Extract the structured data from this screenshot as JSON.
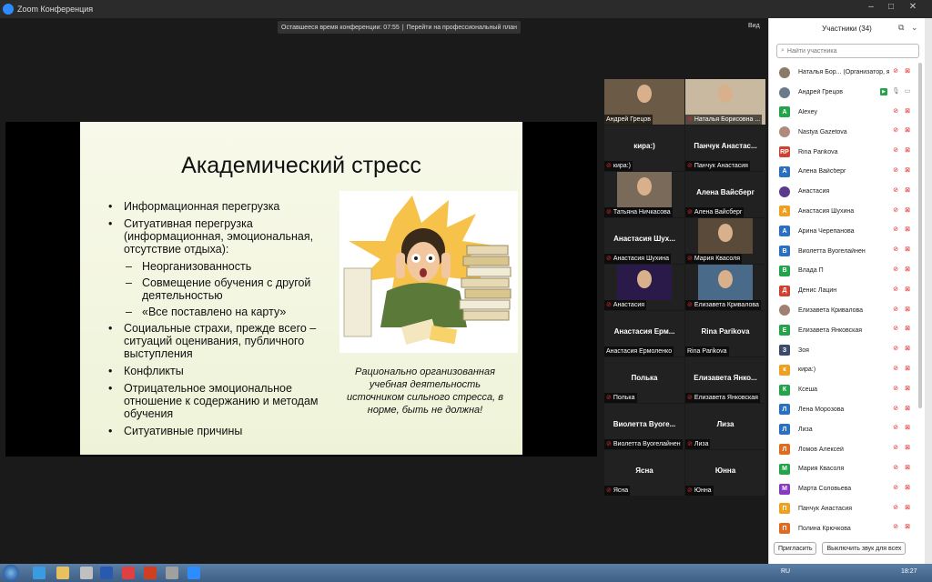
{
  "window": {
    "title": "Zoom Конференция",
    "view_label": "Вид"
  },
  "banner": {
    "time_text": "Оставшееся время конференции: 07:55",
    "upgrade_text": "Перейти на профессиональный план"
  },
  "slide": {
    "title": "Академический стресс",
    "bullets": [
      {
        "text": "Информационная перегрузка",
        "level": 1
      },
      {
        "text": "Ситуативная перегрузка (информационная, эмоциональная, отсутствие отдыха):",
        "level": 1
      },
      {
        "text": "Неорганизованность",
        "level": 2
      },
      {
        "text": "Совмещение обучения с другой деятельностью",
        "level": 2
      },
      {
        "text": "«Все поставлено на карту»",
        "level": 2
      },
      {
        "text": "Социальные страхи, прежде всего – ситуаций оценивания, публичного выступления",
        "level": 1
      },
      {
        "text": "Конфликты",
        "level": 1
      },
      {
        "text": "Отрицательное эмоциональное отношение к содержанию и методам обучения",
        "level": 1
      },
      {
        "text": "Ситуативные причины",
        "level": 1
      }
    ],
    "note": "Рационально организованная учебная деятельность источником сильного стресса, в норме, быть не должна!"
  },
  "gallery": [
    {
      "label": "Андрей Грецов",
      "big": "",
      "video": true,
      "muted": false,
      "active": true
    },
    {
      "label": "Наталья Борисовна ...",
      "big": "",
      "video": true,
      "muted": true,
      "active": false
    },
    {
      "label": "кира:)",
      "big": "кира:)",
      "video": false,
      "muted": true,
      "active": false
    },
    {
      "label": "Панчук Анастасия",
      "big": "Панчук Анастас...",
      "video": false,
      "muted": true,
      "active": false
    },
    {
      "label": "Татьяна Ничкасова",
      "big": "",
      "video": true,
      "muted": true,
      "active": false
    },
    {
      "label": "Алена Вайсберг",
      "big": "Алена Вайсберг",
      "video": false,
      "muted": true,
      "active": false
    },
    {
      "label": "Анастасия Шухина",
      "big": "Анастасия Шух...",
      "video": false,
      "muted": true,
      "active": false
    },
    {
      "label": "Мария Квасоля",
      "big": "",
      "video": true,
      "muted": true,
      "active": false
    },
    {
      "label": "Анастасия",
      "big": "",
      "video": true,
      "muted": true,
      "active": false
    },
    {
      "label": "Елизавета Кривалова",
      "big": "",
      "video": true,
      "muted": true,
      "active": false
    },
    {
      "label": "Анастасия Ермоленко",
      "big": "Анастасия Ерм...",
      "video": false,
      "muted": false,
      "active": false
    },
    {
      "label": "Rina Parikova",
      "big": "Rina Parikova",
      "video": false,
      "muted": false,
      "active": false
    },
    {
      "label": "Полька",
      "big": "Полька",
      "video": false,
      "muted": true,
      "active": false
    },
    {
      "label": "Елизавета Янковская",
      "big": "Елизавета Янко...",
      "video": false,
      "muted": true,
      "active": false
    },
    {
      "label": "Виолетта Вуогелайнен",
      "big": "Виолетта Вуоге...",
      "video": false,
      "muted": true,
      "active": false
    },
    {
      "label": "Лиза",
      "big": "Лиза",
      "video": false,
      "muted": true,
      "active": false
    },
    {
      "label": "Ясна",
      "big": "Ясна",
      "video": false,
      "muted": true,
      "active": false
    },
    {
      "label": "Юнна",
      "big": "Юнна",
      "video": false,
      "muted": true,
      "active": false
    }
  ],
  "participants": {
    "title": "Участники (34)",
    "search_placeholder": "Найти участника",
    "list": [
      {
        "name": "Наталья Бор... (Организатор, я)",
        "avatar": "",
        "color": "#8a7a6a",
        "photo": true,
        "video_on": false,
        "audio_on": false,
        "share": false
      },
      {
        "name": "Андрей Грецов",
        "avatar": "",
        "color": "#6a7a8a",
        "photo": true,
        "video_on": true,
        "audio_on": true,
        "share": true
      },
      {
        "name": "Alexey",
        "avatar": "A",
        "color": "#23a34a"
      },
      {
        "name": "Nastya Gazetova",
        "avatar": "",
        "color": "#b08a7a",
        "photo": true
      },
      {
        "name": "Rina Parikova",
        "avatar": "RP",
        "color": "#d04030"
      },
      {
        "name": "Алена Вайсберг",
        "avatar": "А",
        "color": "#2a6fc0"
      },
      {
        "name": "Анастасия",
        "avatar": "",
        "color": "#5a3a8a",
        "photo": true
      },
      {
        "name": "Анастасия Шухина",
        "avatar": "А",
        "color": "#f0a020"
      },
      {
        "name": "Арина Черепанова",
        "avatar": "А",
        "color": "#2a6fc0"
      },
      {
        "name": "Виолетта Вуогелайнен",
        "avatar": "В",
        "color": "#2a6fc0"
      },
      {
        "name": "Влада П",
        "avatar": "В",
        "color": "#23a34a"
      },
      {
        "name": "Денис Лацин",
        "avatar": "Д",
        "color": "#d04030"
      },
      {
        "name": "Елизавета Кривалова",
        "avatar": "",
        "color": "#a08070",
        "photo": true
      },
      {
        "name": "Елизавета Янковская",
        "avatar": "Е",
        "color": "#23a34a"
      },
      {
        "name": "Зоя",
        "avatar": "З",
        "color": "#3a4a6a"
      },
      {
        "name": "кира:)",
        "avatar": "к",
        "color": "#f0a020"
      },
      {
        "name": "Ксеша",
        "avatar": "К",
        "color": "#23a34a"
      },
      {
        "name": "Лена Морозова",
        "avatar": "Л",
        "color": "#2a6fc0"
      },
      {
        "name": "Лиза",
        "avatar": "Л",
        "color": "#2a6fc0"
      },
      {
        "name": "Ломов Алексей",
        "avatar": "Л",
        "color": "#e06a20"
      },
      {
        "name": "Мария Квасоля",
        "avatar": "М",
        "color": "#23a34a"
      },
      {
        "name": "Марта Соловьева",
        "avatar": "М",
        "color": "#8a3ac0"
      },
      {
        "name": "Панчук Анастасия",
        "avatar": "П",
        "color": "#f0a020"
      },
      {
        "name": "Полина Крючкова",
        "avatar": "П",
        "color": "#e06a20"
      }
    ],
    "invite_label": "Пригласить",
    "mute_all_label": "Выключить звук для всех"
  },
  "taskbar": {
    "lang": "RU",
    "clock": "18:27"
  }
}
